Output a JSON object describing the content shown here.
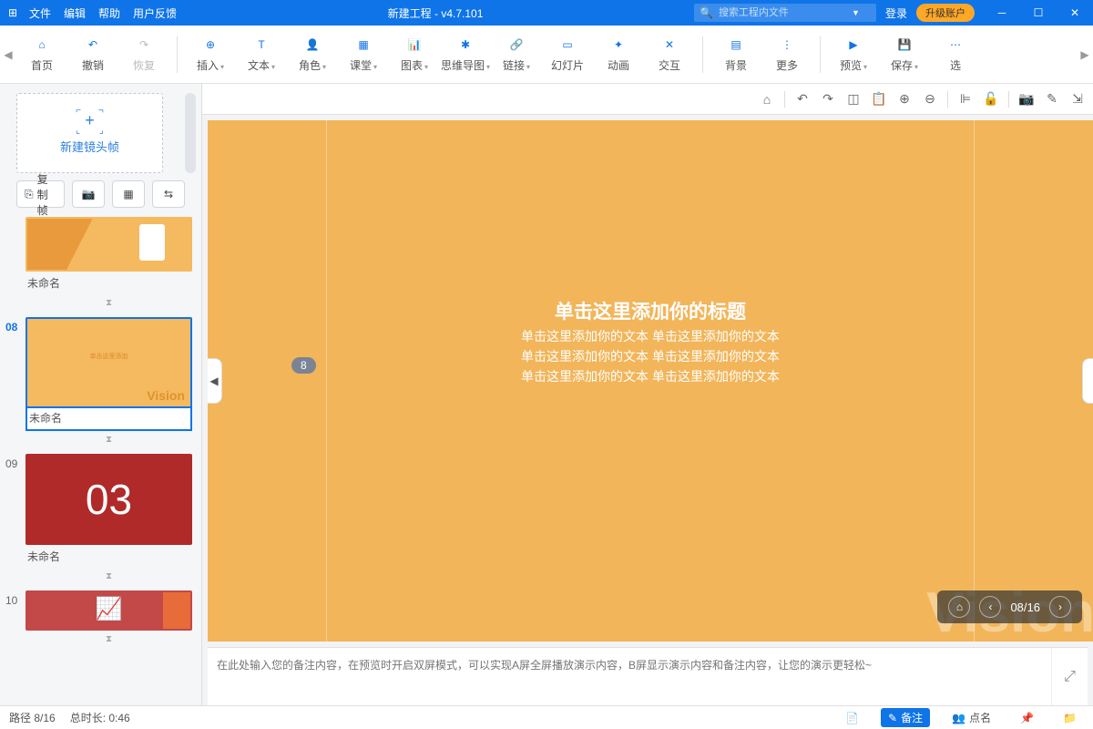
{
  "titlebar": {
    "menus": [
      "文件",
      "编辑",
      "帮助",
      "用户反馈"
    ],
    "title": "新建工程 - v4.7.101",
    "search_placeholder": "搜索工程内文件",
    "login": "登录",
    "upgrade": "升级账户"
  },
  "toolbar": [
    {
      "label": "首页",
      "icon": "home"
    },
    {
      "label": "撤销",
      "icon": "undo"
    },
    {
      "label": "恢复",
      "icon": "redo",
      "dim": true
    },
    {
      "sep": true
    },
    {
      "label": "插入",
      "icon": "plus-circle",
      "dd": true
    },
    {
      "label": "文本",
      "icon": "text",
      "dd": true
    },
    {
      "label": "角色",
      "icon": "person",
      "dd": true
    },
    {
      "label": "课堂",
      "icon": "book",
      "dd": true
    },
    {
      "label": "图表",
      "icon": "chart",
      "dd": true
    },
    {
      "label": "思维导图",
      "icon": "mindmap",
      "dd": true
    },
    {
      "label": "链接",
      "icon": "link",
      "dd": true
    },
    {
      "label": "幻灯片",
      "icon": "slides"
    },
    {
      "label": "动画",
      "icon": "anim"
    },
    {
      "label": "交互",
      "icon": "interact"
    },
    {
      "sep": true
    },
    {
      "label": "背景",
      "icon": "bg"
    },
    {
      "label": "更多",
      "icon": "more"
    },
    {
      "sep": true
    },
    {
      "label": "预览",
      "icon": "play",
      "dd": true
    },
    {
      "label": "保存",
      "icon": "save",
      "dd": true
    },
    {
      "label": "选",
      "icon": "more2"
    }
  ],
  "sidebar": {
    "newframe": "新建镜头帧",
    "copy": "复制帧",
    "slides": [
      {
        "num": "",
        "label": "未命名",
        "partial": true
      },
      {
        "num": "08",
        "label": "未命名",
        "selected": true,
        "vision": "Vision",
        "small_title": "单击这里添加"
      },
      {
        "num": "09",
        "label": "未命名",
        "kind": "red",
        "bignum": "03"
      },
      {
        "num": "10",
        "label": "",
        "kind": "red2"
      }
    ]
  },
  "slide": {
    "title": "单击这里添加你的标题",
    "lines": [
      "单击这里添加你的文本 单击这里添加你的文本",
      "单击这里添加你的文本 单击这里添加你的文本",
      "单击这里添加你的文本 单击这里添加你的文本"
    ],
    "vision": "Vision",
    "marker": "8",
    "nav": "08/16"
  },
  "notes": {
    "placeholder": "在此处输入您的备注内容，在预览时开启双屏模式，可以实现A屏全屏播放演示内容，B屏显示演示内容和备注内容，让您的演示更轻松~"
  },
  "status": {
    "path": "路径 8/16",
    "duration": "总时长: 0:46",
    "beizhu": "备注",
    "dianming": "点名"
  }
}
